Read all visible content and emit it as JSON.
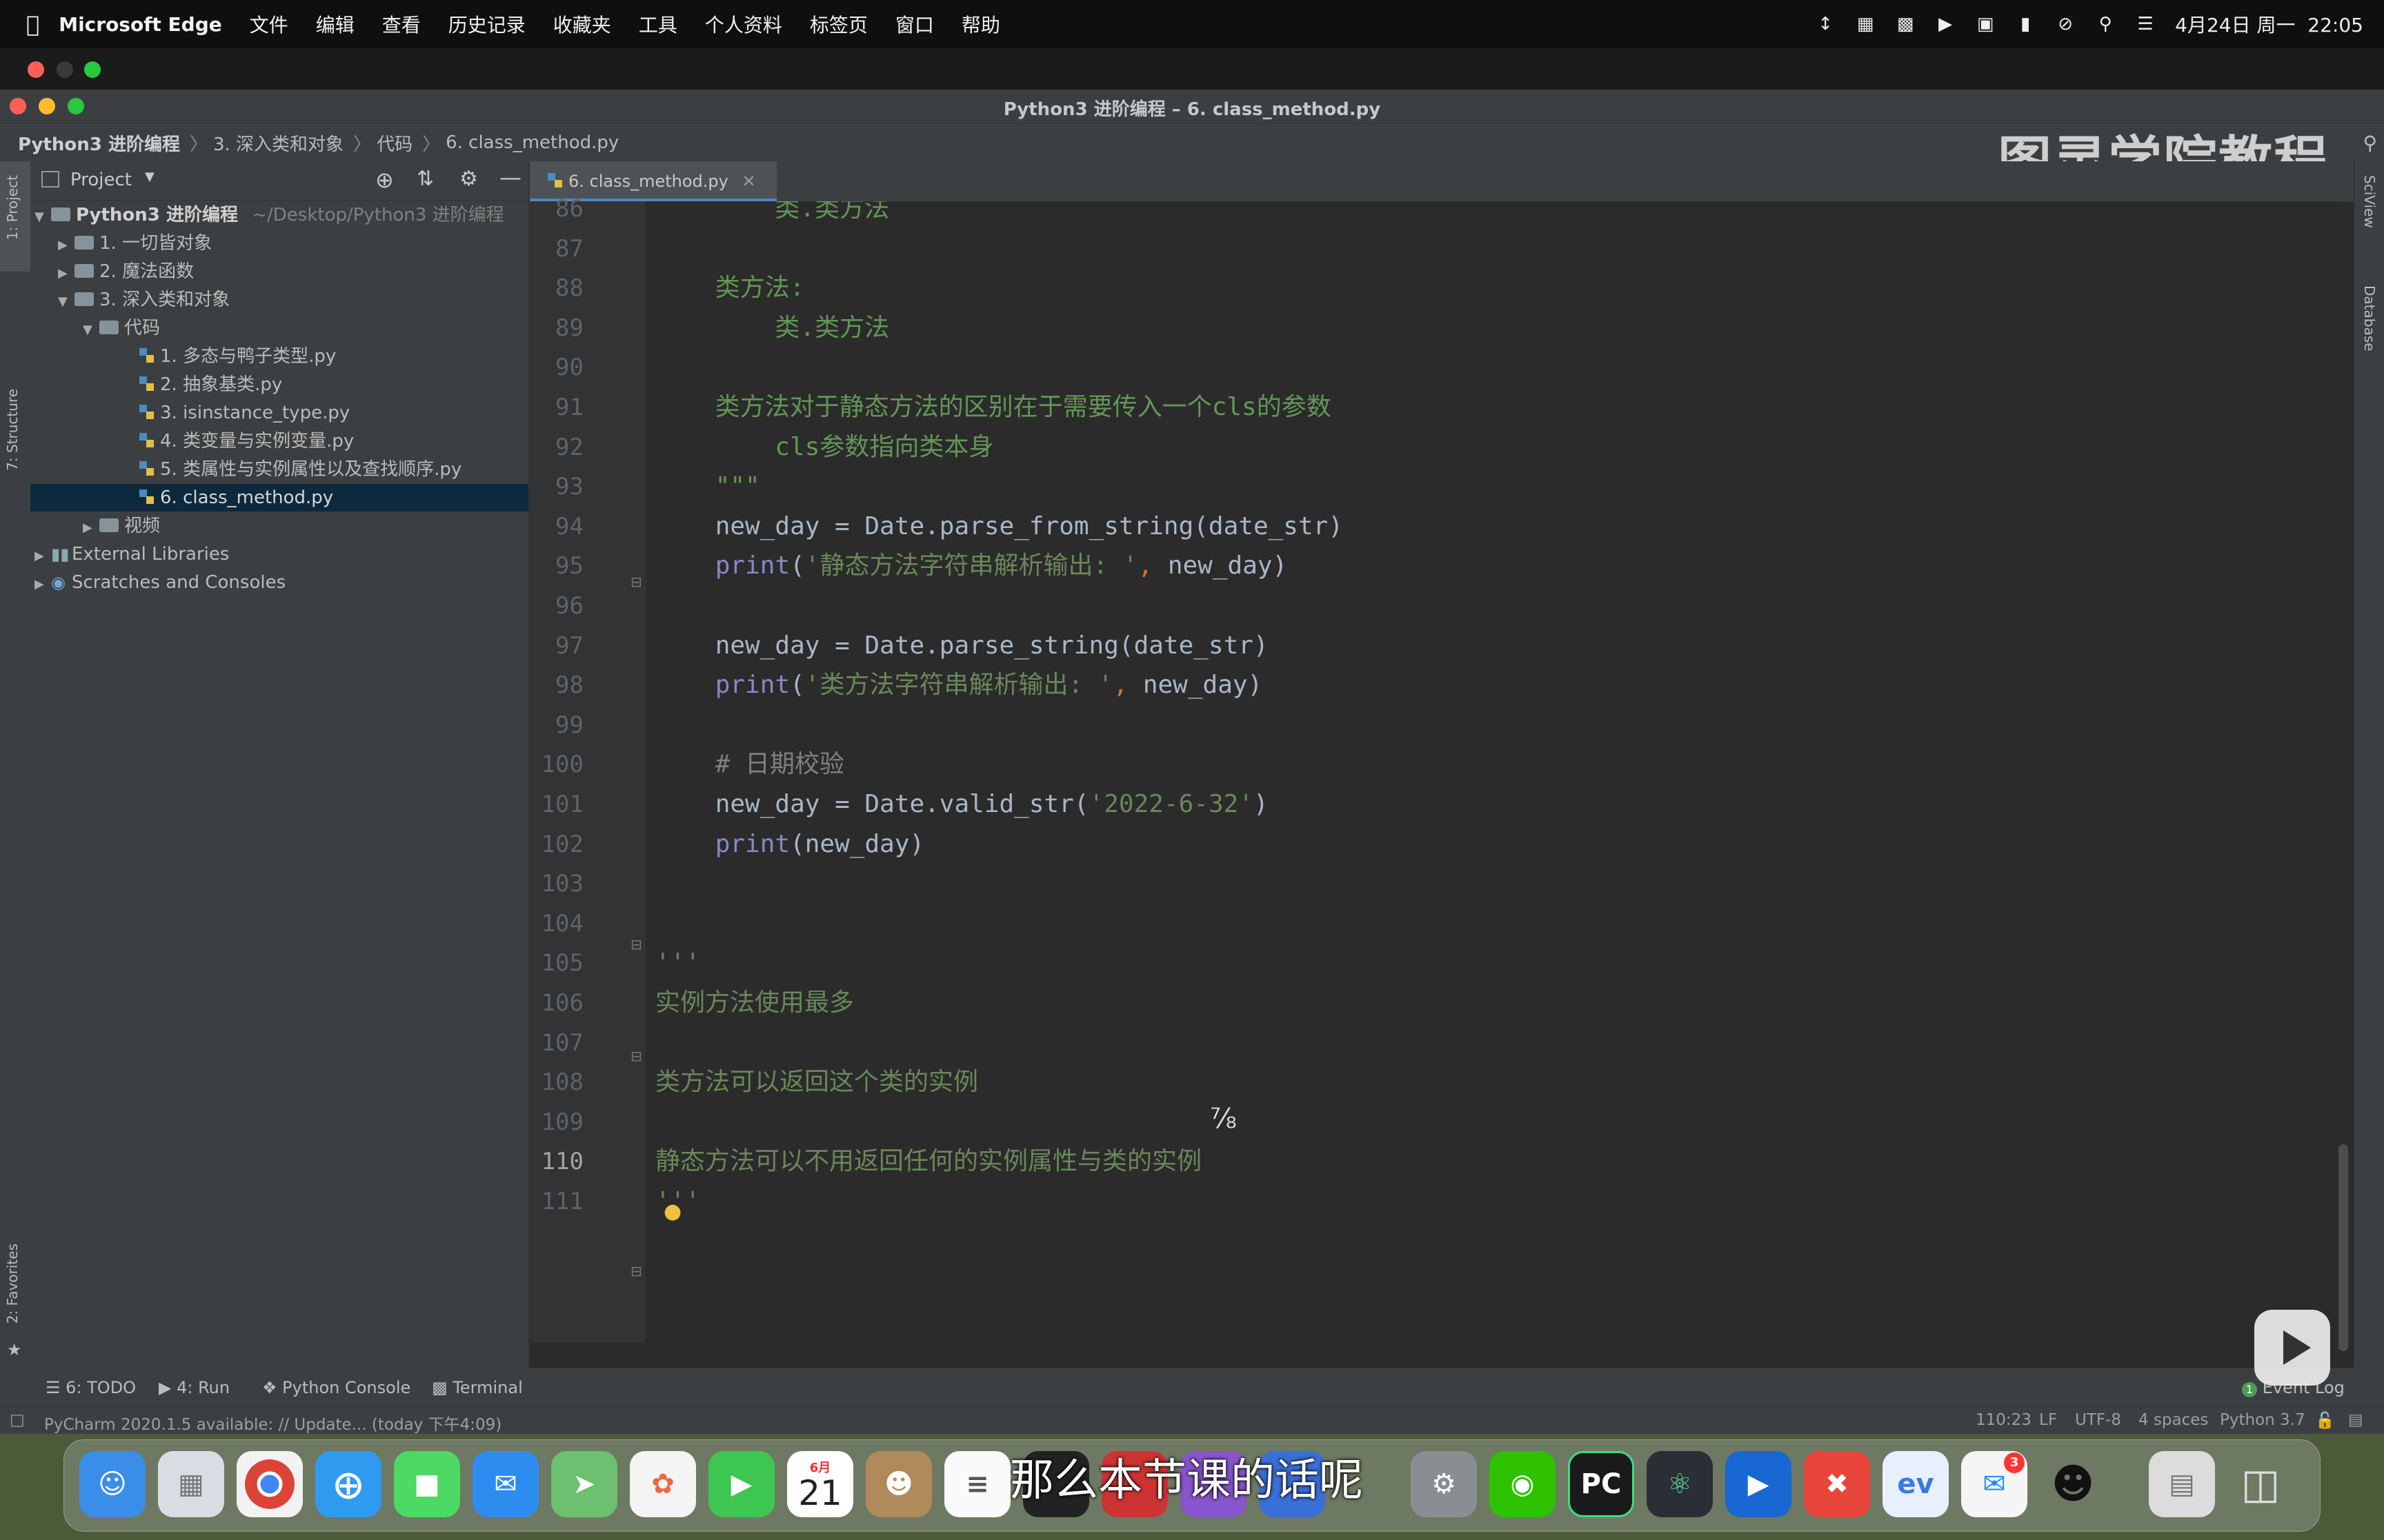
{
  "menubar": {
    "app": "Microsoft Edge",
    "items": [
      "文件",
      "编辑",
      "查看",
      "历史记录",
      "收藏夹",
      "工具",
      "个人资料",
      "标签页",
      "窗口",
      "帮助"
    ],
    "datetime": "4月24日 周一  22:05"
  },
  "window": {
    "title": "Python3 进阶编程 – 6. class_method.py"
  },
  "breadcrumb": [
    "Python3 进阶编程",
    "3. 深入类和对象",
    "代码",
    "6. class_method.py"
  ],
  "watermark": "图灵学院教程",
  "project_panel": {
    "header": "Project",
    "root_name": "Python3 进阶编程",
    "root_path": "~/Desktop/Python3 进阶编程",
    "folders": [
      "1. 一切皆对象",
      "2. 魔法函数",
      "3. 深入类和对象",
      "代码"
    ],
    "files": [
      "1. 多态与鸭子类型.py",
      "2. 抽象基类.py",
      "3. isinstance_type.py",
      "4. 类变量与实例变量.py",
      "5. 类属性与实例属性以及查找顺序.py",
      "6. class_method.py"
    ],
    "video_folder": "视频",
    "external_libraries": "External Libraries",
    "scratches": "Scratches and Consoles"
  },
  "left_tabs": [
    "1: Project",
    "7: Structure",
    "2: Favorites"
  ],
  "right_tabs": [
    "SciView",
    "Database"
  ],
  "editor": {
    "tab": "6. class_method.py",
    "current_line": "110",
    "lines": [
      {
        "n": "86",
        "parts": [
          {
            "t": "        类.类方法",
            "c": "doc"
          }
        ]
      },
      {
        "n": "87",
        "parts": []
      },
      {
        "n": "88",
        "parts": [
          {
            "t": "    类方法:",
            "c": "doc"
          }
        ]
      },
      {
        "n": "89",
        "parts": [
          {
            "t": "        类.类方法",
            "c": "doc"
          }
        ]
      },
      {
        "n": "90",
        "parts": []
      },
      {
        "n": "91",
        "parts": [
          {
            "t": "    类方法对于静态方法的区别在于需要传入一个cls的参数",
            "c": "doc"
          }
        ]
      },
      {
        "n": "92",
        "parts": [
          {
            "t": "        cls参数指向类本身",
            "c": "doc"
          }
        ]
      },
      {
        "n": "93",
        "parts": [
          {
            "t": "    \"\"\"",
            "c": "doc"
          }
        ]
      },
      {
        "n": "94",
        "parts": [
          {
            "t": "    new_day = Date.parse_from_string(date_str)",
            "c": ""
          }
        ]
      },
      {
        "n": "95",
        "parts": [
          {
            "t": "    ",
            "c": ""
          },
          {
            "t": "print",
            "c": "fn"
          },
          {
            "t": "(",
            "c": ""
          },
          {
            "t": "'静态方法字符串解析输出: '",
            "c": "str"
          },
          {
            "t": ", ",
            "c": "kw"
          },
          {
            "t": "new_day)",
            "c": ""
          }
        ]
      },
      {
        "n": "96",
        "parts": []
      },
      {
        "n": "97",
        "parts": [
          {
            "t": "    new_day = Date.parse_string(date_str)",
            "c": ""
          }
        ]
      },
      {
        "n": "98",
        "parts": [
          {
            "t": "    ",
            "c": ""
          },
          {
            "t": "print",
            "c": "fn"
          },
          {
            "t": "(",
            "c": ""
          },
          {
            "t": "'类方法字符串解析输出: '",
            "c": "str"
          },
          {
            "t": ", ",
            "c": "kw"
          },
          {
            "t": "new_day)",
            "c": ""
          }
        ]
      },
      {
        "n": "99",
        "parts": []
      },
      {
        "n": "100",
        "parts": [
          {
            "t": "    # 日期校验",
            "c": "cmt"
          }
        ]
      },
      {
        "n": "101",
        "parts": [
          {
            "t": "    new_day = Date.valid_str(",
            "c": ""
          },
          {
            "t": "'2022-6-32'",
            "c": "str"
          },
          {
            "t": ")",
            "c": ""
          }
        ]
      },
      {
        "n": "102",
        "parts": [
          {
            "t": "    ",
            "c": ""
          },
          {
            "t": "print",
            "c": "fn"
          },
          {
            "t": "(new_day)",
            "c": ""
          }
        ]
      },
      {
        "n": "103",
        "parts": []
      },
      {
        "n": "104",
        "parts": []
      },
      {
        "n": "105",
        "parts": [
          {
            "t": "'''",
            "c": "str"
          }
        ]
      },
      {
        "n": "106",
        "parts": [
          {
            "t": "实例方法使用最多",
            "c": "str"
          }
        ]
      },
      {
        "n": "107",
        "parts": []
      },
      {
        "n": "108",
        "parts": [
          {
            "t": "类方法可以返回这个类的实例",
            "c": "str"
          }
        ]
      },
      {
        "n": "109",
        "parts": []
      },
      {
        "n": "110",
        "parts": [
          {
            "t": "静态方法可以不用返回任何的实例属性与类的实例",
            "c": "str"
          }
        ]
      },
      {
        "n": "111",
        "parts": [
          {
            "t": "'''",
            "c": "str"
          }
        ]
      }
    ]
  },
  "bottom_tools": [
    "6: TODO",
    "4: Run",
    "Python Console",
    "Terminal",
    "Event Log"
  ],
  "event_log_count": "1",
  "statusbar": {
    "message": "PyCharm 2020.1.5 available: // Update... (today 下午4:09)",
    "position": "110:23",
    "line_sep": "LF",
    "encoding": "UTF-8",
    "indent": "4 spaces",
    "interpreter": "Python 3.7"
  },
  "dock": {
    "calendar_month": "6月",
    "calendar_day": "21",
    "qq_mail_badge": "3"
  },
  "subtitle": "那么本节课的话呢",
  "colors": {
    "editor_bg": "#2b2b2b",
    "string": "#6a8759",
    "docstring": "#629755",
    "builtin": "#8888c6",
    "keyword": "#cc7832",
    "comment": "#808080",
    "selection": "#0d293e"
  }
}
